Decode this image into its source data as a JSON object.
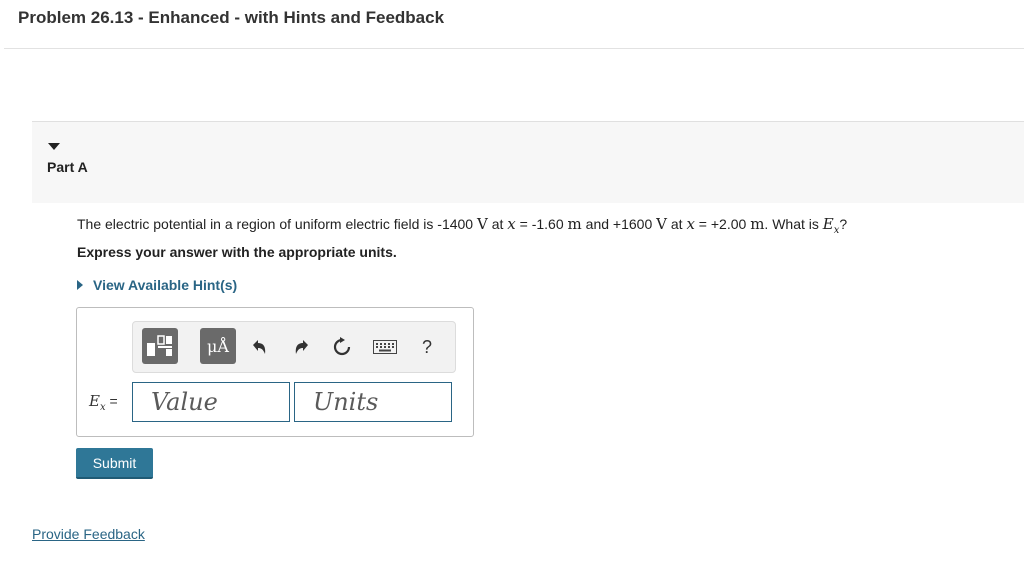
{
  "header": {
    "title": "Problem 26.13 - Enhanced - with Hints and Feedback"
  },
  "part": {
    "label": "Part A"
  },
  "question": {
    "t1": "The electric potential in a region of uniform electric field is -1400 ",
    "unit_v": "V",
    "t2": " at ",
    "var_x": "x",
    "t3": " = -1.60 ",
    "unit_m": "m",
    "t4": " and +1600 ",
    "t5": " at ",
    "t6": " = +2.00 ",
    "t7": ". What is ",
    "var_E": "E",
    "sub_x": "x",
    "t8": "?"
  },
  "instruction": "Express your answer with the appropriate units.",
  "hints": {
    "label": "View Available Hint(s)"
  },
  "toolbar": {
    "units_button": "μÅ",
    "help": "?",
    "icons": [
      "template-icon",
      "undo-icon",
      "redo-icon",
      "reset-icon",
      "keyboard-icon",
      "help-icon"
    ]
  },
  "answer": {
    "var_label": "E",
    "var_sub": "x",
    "equals": " =",
    "value_placeholder": "Value",
    "units_placeholder": "Units"
  },
  "submit_label": "Submit",
  "feedback_label": "Provide Feedback",
  "colors": {
    "link": "#2a6585",
    "submit": "#2f7797",
    "toolbar_button": "#6a6a6a"
  }
}
